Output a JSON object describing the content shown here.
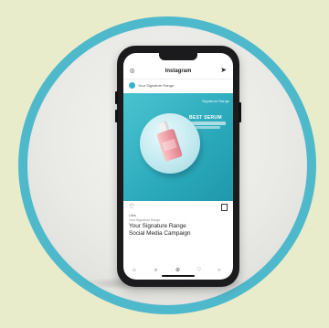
{
  "app": {
    "brand": "Instagram",
    "profile_name": "Your Signature Range"
  },
  "post": {
    "logo_text": "Signature Range",
    "headline": "BEST SERUM",
    "likes_text": "Likes",
    "by_text": "Your Signature Range",
    "caption_line1": "Your Signature Range",
    "caption_line2": "Social Media Campaign"
  },
  "icons": {
    "camera": "camera-icon",
    "send": "send-icon",
    "heart": "heart-icon",
    "bookmark": "bookmark-icon",
    "home": "home-icon",
    "search": "search-icon",
    "add": "add-icon",
    "activity": "activity-icon",
    "profile": "profile-icon"
  },
  "colors": {
    "background": "#e9ecca",
    "ring": "#4fb9cc",
    "post_teal": "#2aa9bb",
    "bottle_pink": "#f09ba4"
  }
}
